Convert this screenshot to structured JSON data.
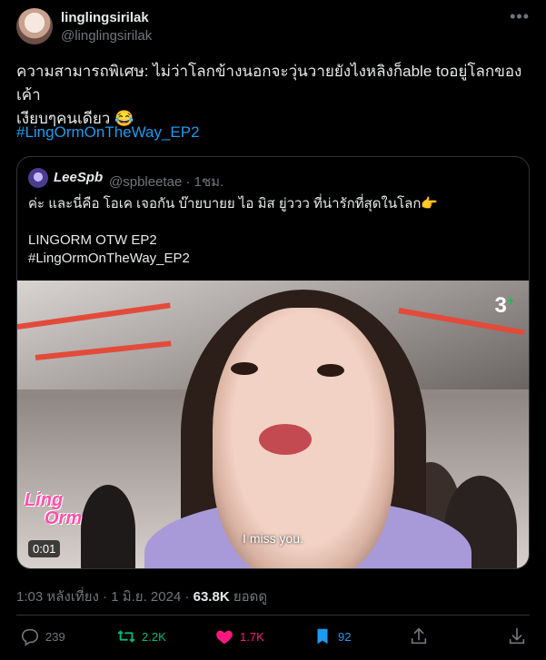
{
  "author": {
    "display_name": "linglingsirilak",
    "handle": "@linglingsirilak"
  },
  "tweet": {
    "text": "ความสามารถพิเศษ: ไม่ว่าโลกข้างนอกจะวุ่นวายยังไงหลิงก็able toอยู่โลกของเค้า\nเงียบๆคนเดียว 😂",
    "hashtag": "#LingOrmOnTheWay_EP2",
    "more_icon": "more-horizontal-icon"
  },
  "quoted": {
    "display_name": "LeeSpb",
    "handle_time": "@spbleetae · 1ชม.",
    "text": "ค่ะ และนี่คือ โอเค เจอกัน บ๊ายบายย ไอ มิส ยู่ววว ที่น่ารักที่สุดในโลก👉\n\nLINGORM OTW EP2\n#LingOrmOnTheWay_EP2",
    "media": {
      "subtitle": "I miss you.",
      "duration": "0:01",
      "channel_logo": "3",
      "channel_logo_plus": "+",
      "brand_line1": "Ling",
      "brand_line2": "Orm"
    }
  },
  "meta": {
    "time": "1:03 หลังเที่ยง · 1 มิ.ย. 2024 · ",
    "views": "63.8K",
    "views_label": " ยอดดู"
  },
  "actions": {
    "reply_count": "239",
    "retweet_count": "2.2K",
    "like_count": "1.7K",
    "bookmark_count": "92"
  },
  "colors": {
    "link": "#1d9bf0",
    "retweet": "#00ba7c",
    "like": "#f91880",
    "bookmark": "#1d9bf0",
    "muted": "#71767b"
  }
}
